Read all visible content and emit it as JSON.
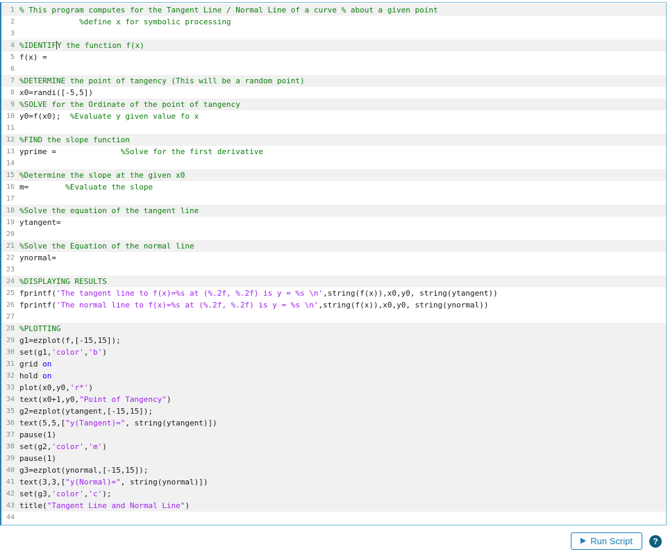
{
  "colors": {
    "comment": "#0c7f0c",
    "string": "#a020f0",
    "keyword": "#0e00ff",
    "plain": "#1a1a1a",
    "accent": "#1b7eb5",
    "help_bg": "#0e617e",
    "locked_bg": "#f1f1f1",
    "border": "#7ab8d9",
    "border_left": "#2a7fb5",
    "linenum": "#8a8a8a"
  },
  "editor": {
    "language": "matlab",
    "lines": [
      {
        "n": 1,
        "locked": true,
        "tokens": [
          {
            "c": "comment",
            "t": "% This program computes for the Tangent Line / Normal Line of a curve % about a given point"
          }
        ]
      },
      {
        "n": 2,
        "locked": false,
        "tokens": [
          {
            "c": "comment",
            "t": "             %define x for symbolic processing"
          }
        ]
      },
      {
        "n": 3,
        "locked": false,
        "tokens": []
      },
      {
        "n": 4,
        "locked": true,
        "tokens": [
          {
            "c": "comment",
            "t": "%IDENTIF"
          },
          {
            "c": "caret",
            "t": ""
          },
          {
            "c": "comment",
            "t": "Y the function f(x)"
          }
        ]
      },
      {
        "n": 5,
        "locked": false,
        "tokens": [
          {
            "c": "plain",
            "t": "f(x) ="
          }
        ]
      },
      {
        "n": 6,
        "locked": false,
        "tokens": []
      },
      {
        "n": 7,
        "locked": true,
        "tokens": [
          {
            "c": "comment",
            "t": "%DETERMINE the point of tangency (This will be a random point)"
          }
        ]
      },
      {
        "n": 8,
        "locked": false,
        "tokens": [
          {
            "c": "plain",
            "t": "x0=randi([-5,5])"
          }
        ]
      },
      {
        "n": 9,
        "locked": true,
        "tokens": [
          {
            "c": "comment",
            "t": "%SOLVE for the Ordinate of the point of tangency"
          }
        ]
      },
      {
        "n": 10,
        "locked": false,
        "tokens": [
          {
            "c": "plain",
            "t": "y0=f(x0);  "
          },
          {
            "c": "comment",
            "t": "%Evaluate y given value fo x"
          }
        ]
      },
      {
        "n": 11,
        "locked": false,
        "tokens": []
      },
      {
        "n": 12,
        "locked": true,
        "tokens": [
          {
            "c": "comment",
            "t": "%FIND the slope function"
          }
        ]
      },
      {
        "n": 13,
        "locked": false,
        "tokens": [
          {
            "c": "plain",
            "t": "yprime =              "
          },
          {
            "c": "comment",
            "t": "%Solve for the first derivative"
          }
        ]
      },
      {
        "n": 14,
        "locked": false,
        "tokens": []
      },
      {
        "n": 15,
        "locked": true,
        "tokens": [
          {
            "c": "comment",
            "t": "%Determine the slope at the given x0"
          }
        ]
      },
      {
        "n": 16,
        "locked": false,
        "tokens": [
          {
            "c": "plain",
            "t": "m=        "
          },
          {
            "c": "comment",
            "t": "%Evaluate the slope"
          }
        ]
      },
      {
        "n": 17,
        "locked": false,
        "tokens": []
      },
      {
        "n": 18,
        "locked": true,
        "tokens": [
          {
            "c": "comment",
            "t": "%Solve the equation of the tangent line"
          }
        ]
      },
      {
        "n": 19,
        "locked": false,
        "tokens": [
          {
            "c": "plain",
            "t": "ytangent="
          }
        ]
      },
      {
        "n": 20,
        "locked": false,
        "tokens": []
      },
      {
        "n": 21,
        "locked": true,
        "tokens": [
          {
            "c": "comment",
            "t": "%Solve the Equation of the normal line"
          }
        ]
      },
      {
        "n": 22,
        "locked": false,
        "tokens": [
          {
            "c": "plain",
            "t": "ynormal="
          }
        ]
      },
      {
        "n": 23,
        "locked": false,
        "tokens": []
      },
      {
        "n": 24,
        "locked": true,
        "tokens": [
          {
            "c": "comment",
            "t": "%DISPLAYING RESULTS"
          }
        ]
      },
      {
        "n": 25,
        "locked": false,
        "tokens": [
          {
            "c": "plain",
            "t": "fprintf("
          },
          {
            "c": "string",
            "t": "'The tangent line to f(x)=%s at (%.2f, %.2f) is y = %s \\n'"
          },
          {
            "c": "plain",
            "t": ",string(f(x)),x0,y0, string(ytangent))"
          }
        ]
      },
      {
        "n": 26,
        "locked": false,
        "tokens": [
          {
            "c": "plain",
            "t": "fprintf("
          },
          {
            "c": "string",
            "t": "'The normal line to f(x)=%s at (%.2f, %.2f) is y = %s \\n'"
          },
          {
            "c": "plain",
            "t": ",string(f(x)),x0,y0, string(ynormal))"
          }
        ]
      },
      {
        "n": 27,
        "locked": false,
        "tokens": []
      },
      {
        "n": 28,
        "locked": true,
        "tokens": [
          {
            "c": "comment",
            "t": "%PLOTTING"
          }
        ]
      },
      {
        "n": 29,
        "locked": true,
        "tokens": [
          {
            "c": "plain",
            "t": "g1=ezplot(f,[-15,15]);"
          }
        ]
      },
      {
        "n": 30,
        "locked": true,
        "tokens": [
          {
            "c": "plain",
            "t": "set(g1,"
          },
          {
            "c": "string",
            "t": "'color'"
          },
          {
            "c": "plain",
            "t": ","
          },
          {
            "c": "string",
            "t": "'b'"
          },
          {
            "c": "plain",
            "t": ")"
          }
        ]
      },
      {
        "n": 31,
        "locked": true,
        "tokens": [
          {
            "c": "plain",
            "t": "grid "
          },
          {
            "c": "keyword",
            "t": "on"
          }
        ]
      },
      {
        "n": 32,
        "locked": true,
        "tokens": [
          {
            "c": "plain",
            "t": "hold "
          },
          {
            "c": "keyword",
            "t": "on"
          }
        ]
      },
      {
        "n": 33,
        "locked": true,
        "tokens": [
          {
            "c": "plain",
            "t": "plot(x0,y0,"
          },
          {
            "c": "string",
            "t": "'r*'"
          },
          {
            "c": "plain",
            "t": ")"
          }
        ]
      },
      {
        "n": 34,
        "locked": true,
        "tokens": [
          {
            "c": "plain",
            "t": "text(x0+1,y0,"
          },
          {
            "c": "string",
            "t": "\"Point of Tangency\""
          },
          {
            "c": "plain",
            "t": ")"
          }
        ]
      },
      {
        "n": 35,
        "locked": true,
        "tokens": [
          {
            "c": "plain",
            "t": "g2=ezplot(ytangent,[-15,15]);"
          }
        ]
      },
      {
        "n": 36,
        "locked": true,
        "tokens": [
          {
            "c": "plain",
            "t": "text(5,5,["
          },
          {
            "c": "string",
            "t": "\"y(Tangent)=\""
          },
          {
            "c": "plain",
            "t": ", string(ytangent)])"
          }
        ]
      },
      {
        "n": 37,
        "locked": true,
        "tokens": [
          {
            "c": "plain",
            "t": "pause(1)"
          }
        ]
      },
      {
        "n": 38,
        "locked": true,
        "tokens": [
          {
            "c": "plain",
            "t": "set(g2,"
          },
          {
            "c": "string",
            "t": "'color'"
          },
          {
            "c": "plain",
            "t": ","
          },
          {
            "c": "string",
            "t": "'m'"
          },
          {
            "c": "plain",
            "t": ")"
          }
        ]
      },
      {
        "n": 39,
        "locked": true,
        "tokens": [
          {
            "c": "plain",
            "t": "pause(1)"
          }
        ]
      },
      {
        "n": 40,
        "locked": true,
        "tokens": [
          {
            "c": "plain",
            "t": "g3=ezplot(ynormal,[-15,15]);"
          }
        ]
      },
      {
        "n": 41,
        "locked": true,
        "tokens": [
          {
            "c": "plain",
            "t": "text(3,3,["
          },
          {
            "c": "string",
            "t": "\"y(Normal)=\""
          },
          {
            "c": "plain",
            "t": ", string(ynormal)])"
          }
        ]
      },
      {
        "n": 42,
        "locked": true,
        "tokens": [
          {
            "c": "plain",
            "t": "set(g3,"
          },
          {
            "c": "string",
            "t": "'color'"
          },
          {
            "c": "plain",
            "t": ","
          },
          {
            "c": "string",
            "t": "'c'"
          },
          {
            "c": "plain",
            "t": ");"
          }
        ]
      },
      {
        "n": 43,
        "locked": true,
        "tokens": [
          {
            "c": "plain",
            "t": "title("
          },
          {
            "c": "string",
            "t": "\"Tangent Line and Normal Line\""
          },
          {
            "c": "plain",
            "t": ")"
          }
        ]
      },
      {
        "n": 44,
        "locked": false,
        "tokens": []
      }
    ]
  },
  "footer": {
    "play_icon": "▶",
    "run_button_label": "Run Script",
    "help_glyph": "?"
  }
}
